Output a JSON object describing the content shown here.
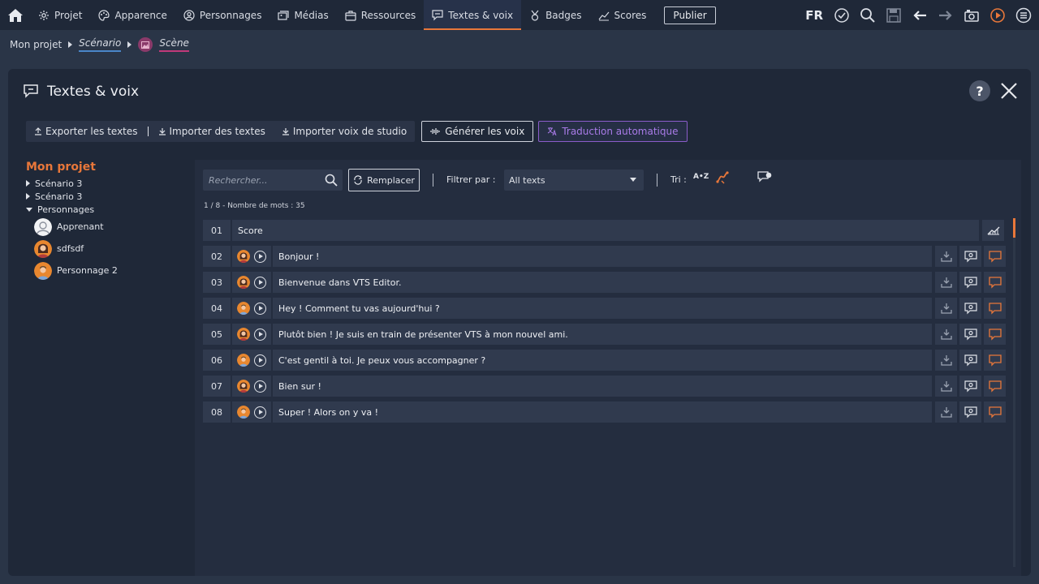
{
  "nav": {
    "items": [
      {
        "label": "Projet",
        "icon": "gear-icon"
      },
      {
        "label": "Apparence",
        "icon": "palette-icon"
      },
      {
        "label": "Personnages",
        "icon": "person-icon"
      },
      {
        "label": "Médias",
        "icon": "media-icon"
      },
      {
        "label": "Ressources",
        "icon": "briefcase-icon"
      },
      {
        "label": "Textes & voix",
        "icon": "speech-bubble-icon"
      },
      {
        "label": "Badges",
        "icon": "badge-icon"
      },
      {
        "label": "Scores",
        "icon": "chart-icon"
      }
    ],
    "active_index": 5,
    "publish_label": "Publier",
    "language": "FR"
  },
  "breadcrumb": {
    "project": "Mon projet",
    "scenario": "Scénario",
    "scene": "Scène"
  },
  "panel": {
    "title": "Textes & voix",
    "help": "?",
    "actions": {
      "export": "Exporter les textes",
      "import": "Importer des textes",
      "import_studio": "Importer voix de studio",
      "generate": "Générer les voix",
      "translate": "Traduction automatique"
    }
  },
  "tree": {
    "root": "Mon projet",
    "scenarios": [
      "Scénario 3",
      "Scénario 3"
    ],
    "characters_label": "Personnages",
    "characters": [
      "Apprenant",
      "sdfsdf",
      "Personnage 2"
    ]
  },
  "toolbar": {
    "search_placeholder": "Rechercher...",
    "replace": "Remplacer",
    "filter_label": "Filtrer par :",
    "filter_value": "All texts",
    "sort_label": "Tri :",
    "sort_az": "A•Z"
  },
  "list": {
    "count": "1 / 8",
    "word_count": "Nombre de mots : 35",
    "rows": [
      {
        "num": "01",
        "text": "Score",
        "type": "score"
      },
      {
        "num": "02",
        "text": "Bonjour !",
        "avatar": "female"
      },
      {
        "num": "03",
        "text": "Bienvenue dans VTS Editor.",
        "avatar": "female"
      },
      {
        "num": "04",
        "text": "Hey ! Comment tu vas aujourd'hui ?",
        "avatar": "male"
      },
      {
        "num": "05",
        "text": "Plutôt bien ! Je suis en train de présenter VTS à mon nouvel ami.",
        "avatar": "female"
      },
      {
        "num": "06",
        "text": "C'est gentil à toi. Je peux vous accompagner ?",
        "avatar": "male"
      },
      {
        "num": "07",
        "text": "Bien sur !",
        "avatar": "female"
      },
      {
        "num": "08",
        "text": "Super ! Alors on y va !",
        "avatar": "male"
      }
    ]
  },
  "colors": {
    "accent": "#e8773a",
    "purple": "#8a5cc9",
    "panel": "#1f2838"
  }
}
